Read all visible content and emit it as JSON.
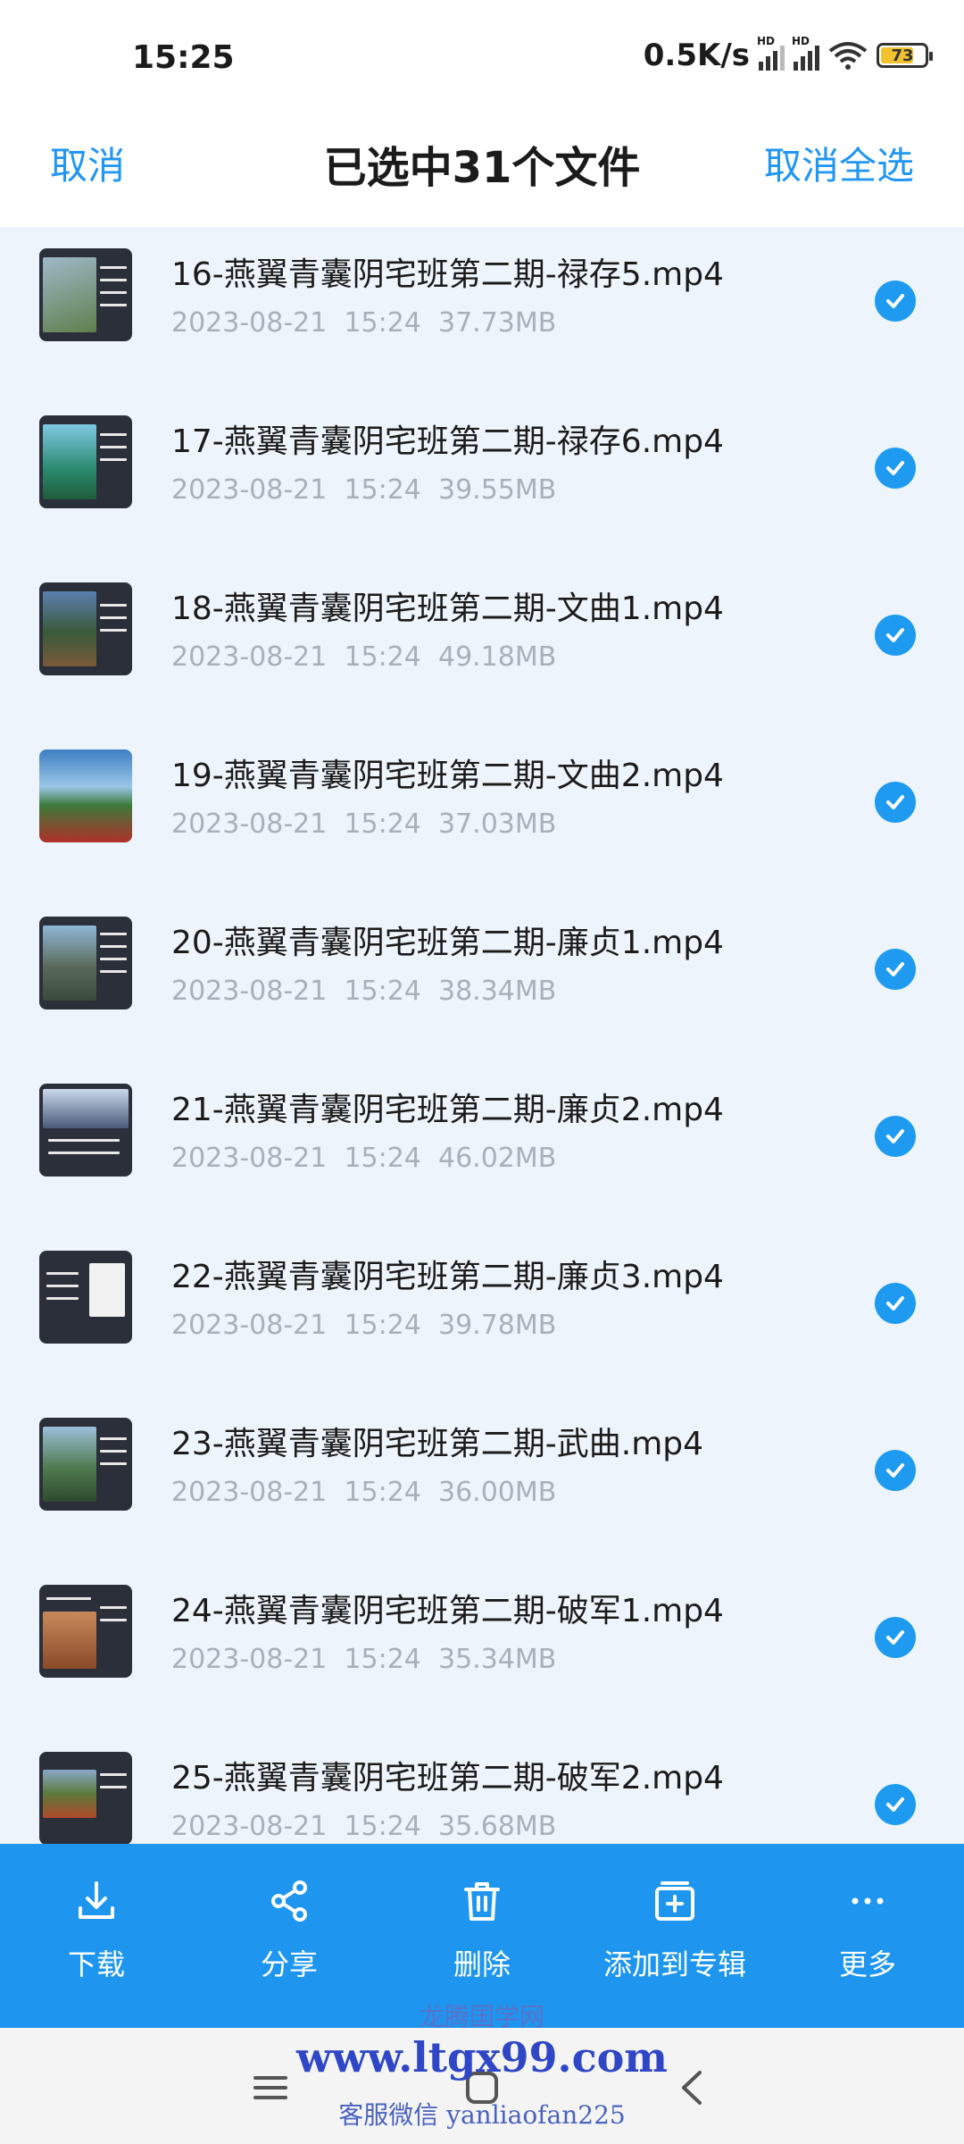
{
  "status_bar": {
    "time": "15:25",
    "network_speed": "0.5K/s",
    "battery_level": "73",
    "hd_label": "HD"
  },
  "header": {
    "cancel_label": "取消",
    "title": "已选中31个文件",
    "deselect_all_label": "取消全选"
  },
  "files": [
    {
      "name": "16-燕翼青囊阴宅班第二期-禄存5.mp4",
      "date": "2023-08-21",
      "time": "15:24",
      "size": "37.73MB"
    },
    {
      "name": "17-燕翼青囊阴宅班第二期-禄存6.mp4",
      "date": "2023-08-21",
      "time": "15:24",
      "size": "39.55MB"
    },
    {
      "name": "18-燕翼青囊阴宅班第二期-文曲1.mp4",
      "date": "2023-08-21",
      "time": "15:24",
      "size": "49.18MB"
    },
    {
      "name": "19-燕翼青囊阴宅班第二期-文曲2.mp4",
      "date": "2023-08-21",
      "time": "15:24",
      "size": "37.03MB"
    },
    {
      "name": "20-燕翼青囊阴宅班第二期-廉贞1.mp4",
      "date": "2023-08-21",
      "time": "15:24",
      "size": "38.34MB"
    },
    {
      "name": "21-燕翼青囊阴宅班第二期-廉贞2.mp4",
      "date": "2023-08-21",
      "time": "15:24",
      "size": "46.02MB"
    },
    {
      "name": "22-燕翼青囊阴宅班第二期-廉贞3.mp4",
      "date": "2023-08-21",
      "time": "15:24",
      "size": "39.78MB"
    },
    {
      "name": "23-燕翼青囊阴宅班第二期-武曲.mp4",
      "date": "2023-08-21",
      "time": "15:24",
      "size": "36.00MB"
    },
    {
      "name": "24-燕翼青囊阴宅班第二期-破军1.mp4",
      "date": "2023-08-21",
      "time": "15:24",
      "size": "35.34MB"
    },
    {
      "name": "25-燕翼青囊阴宅班第二期-破军2.mp4",
      "date": "2023-08-21",
      "time": "15:24",
      "size": "35.68MB"
    }
  ],
  "actions": [
    {
      "label": "下载",
      "icon": "download-icon"
    },
    {
      "label": "分享",
      "icon": "share-icon"
    },
    {
      "label": "删除",
      "icon": "trash-icon"
    },
    {
      "label": "添加到专辑",
      "icon": "add-to-album-icon"
    },
    {
      "label": "更多",
      "icon": "more-icon"
    }
  ],
  "watermark": {
    "line1": "龙腾国学网",
    "line2": "www.ltgx99.com",
    "line3": "客服微信 yanliaofan225"
  },
  "colors": {
    "accent": "#2196f3",
    "action_bar": "#1e96f0",
    "check": "#1e9bf0"
  }
}
